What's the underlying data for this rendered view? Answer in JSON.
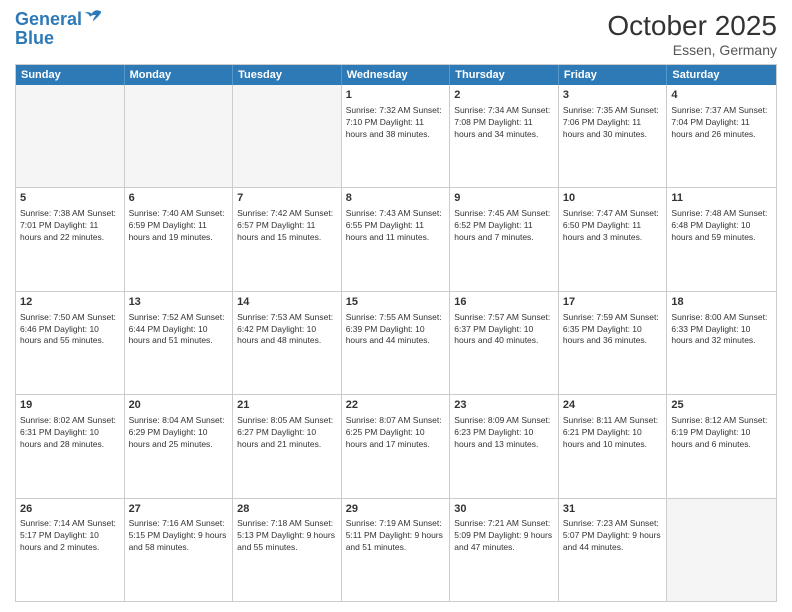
{
  "header": {
    "logo_line1": "General",
    "logo_line2": "Blue",
    "month": "October 2025",
    "location": "Essen, Germany"
  },
  "weekdays": [
    "Sunday",
    "Monday",
    "Tuesday",
    "Wednesday",
    "Thursday",
    "Friday",
    "Saturday"
  ],
  "rows": [
    [
      {
        "day": "",
        "info": ""
      },
      {
        "day": "",
        "info": ""
      },
      {
        "day": "",
        "info": ""
      },
      {
        "day": "1",
        "info": "Sunrise: 7:32 AM\nSunset: 7:10 PM\nDaylight: 11 hours\nand 38 minutes."
      },
      {
        "day": "2",
        "info": "Sunrise: 7:34 AM\nSunset: 7:08 PM\nDaylight: 11 hours\nand 34 minutes."
      },
      {
        "day": "3",
        "info": "Sunrise: 7:35 AM\nSunset: 7:06 PM\nDaylight: 11 hours\nand 30 minutes."
      },
      {
        "day": "4",
        "info": "Sunrise: 7:37 AM\nSunset: 7:04 PM\nDaylight: 11 hours\nand 26 minutes."
      }
    ],
    [
      {
        "day": "5",
        "info": "Sunrise: 7:38 AM\nSunset: 7:01 PM\nDaylight: 11 hours\nand 22 minutes."
      },
      {
        "day": "6",
        "info": "Sunrise: 7:40 AM\nSunset: 6:59 PM\nDaylight: 11 hours\nand 19 minutes."
      },
      {
        "day": "7",
        "info": "Sunrise: 7:42 AM\nSunset: 6:57 PM\nDaylight: 11 hours\nand 15 minutes."
      },
      {
        "day": "8",
        "info": "Sunrise: 7:43 AM\nSunset: 6:55 PM\nDaylight: 11 hours\nand 11 minutes."
      },
      {
        "day": "9",
        "info": "Sunrise: 7:45 AM\nSunset: 6:52 PM\nDaylight: 11 hours\nand 7 minutes."
      },
      {
        "day": "10",
        "info": "Sunrise: 7:47 AM\nSunset: 6:50 PM\nDaylight: 11 hours\nand 3 minutes."
      },
      {
        "day": "11",
        "info": "Sunrise: 7:48 AM\nSunset: 6:48 PM\nDaylight: 10 hours\nand 59 minutes."
      }
    ],
    [
      {
        "day": "12",
        "info": "Sunrise: 7:50 AM\nSunset: 6:46 PM\nDaylight: 10 hours\nand 55 minutes."
      },
      {
        "day": "13",
        "info": "Sunrise: 7:52 AM\nSunset: 6:44 PM\nDaylight: 10 hours\nand 51 minutes."
      },
      {
        "day": "14",
        "info": "Sunrise: 7:53 AM\nSunset: 6:42 PM\nDaylight: 10 hours\nand 48 minutes."
      },
      {
        "day": "15",
        "info": "Sunrise: 7:55 AM\nSunset: 6:39 PM\nDaylight: 10 hours\nand 44 minutes."
      },
      {
        "day": "16",
        "info": "Sunrise: 7:57 AM\nSunset: 6:37 PM\nDaylight: 10 hours\nand 40 minutes."
      },
      {
        "day": "17",
        "info": "Sunrise: 7:59 AM\nSunset: 6:35 PM\nDaylight: 10 hours\nand 36 minutes."
      },
      {
        "day": "18",
        "info": "Sunrise: 8:00 AM\nSunset: 6:33 PM\nDaylight: 10 hours\nand 32 minutes."
      }
    ],
    [
      {
        "day": "19",
        "info": "Sunrise: 8:02 AM\nSunset: 6:31 PM\nDaylight: 10 hours\nand 28 minutes."
      },
      {
        "day": "20",
        "info": "Sunrise: 8:04 AM\nSunset: 6:29 PM\nDaylight: 10 hours\nand 25 minutes."
      },
      {
        "day": "21",
        "info": "Sunrise: 8:05 AM\nSunset: 6:27 PM\nDaylight: 10 hours\nand 21 minutes."
      },
      {
        "day": "22",
        "info": "Sunrise: 8:07 AM\nSunset: 6:25 PM\nDaylight: 10 hours\nand 17 minutes."
      },
      {
        "day": "23",
        "info": "Sunrise: 8:09 AM\nSunset: 6:23 PM\nDaylight: 10 hours\nand 13 minutes."
      },
      {
        "day": "24",
        "info": "Sunrise: 8:11 AM\nSunset: 6:21 PM\nDaylight: 10 hours\nand 10 minutes."
      },
      {
        "day": "25",
        "info": "Sunrise: 8:12 AM\nSunset: 6:19 PM\nDaylight: 10 hours\nand 6 minutes."
      }
    ],
    [
      {
        "day": "26",
        "info": "Sunrise: 7:14 AM\nSunset: 5:17 PM\nDaylight: 10 hours\nand 2 minutes."
      },
      {
        "day": "27",
        "info": "Sunrise: 7:16 AM\nSunset: 5:15 PM\nDaylight: 9 hours\nand 58 minutes."
      },
      {
        "day": "28",
        "info": "Sunrise: 7:18 AM\nSunset: 5:13 PM\nDaylight: 9 hours\nand 55 minutes."
      },
      {
        "day": "29",
        "info": "Sunrise: 7:19 AM\nSunset: 5:11 PM\nDaylight: 9 hours\nand 51 minutes."
      },
      {
        "day": "30",
        "info": "Sunrise: 7:21 AM\nSunset: 5:09 PM\nDaylight: 9 hours\nand 47 minutes."
      },
      {
        "day": "31",
        "info": "Sunrise: 7:23 AM\nSunset: 5:07 PM\nDaylight: 9 hours\nand 44 minutes."
      },
      {
        "day": "",
        "info": ""
      }
    ]
  ]
}
